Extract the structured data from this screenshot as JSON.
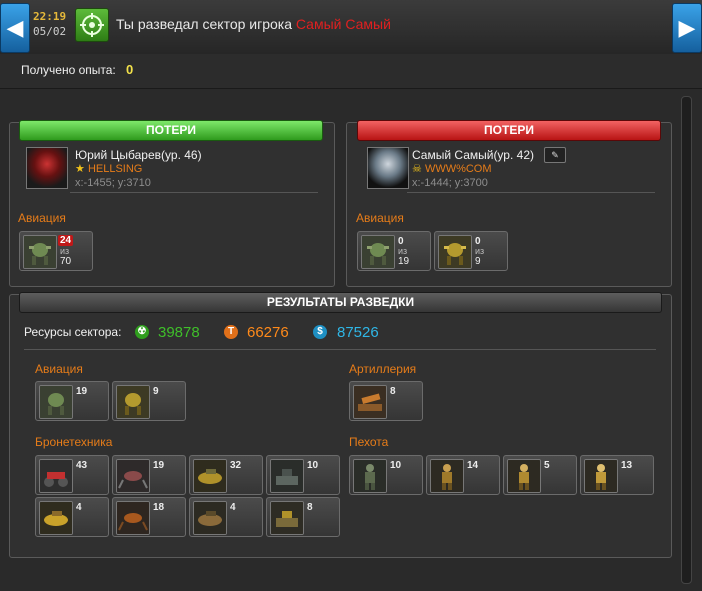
{
  "header": {
    "time": "22:19",
    "date": "05/02",
    "message": "Ты разведал сектор игрока",
    "target_name": "Самый Самый"
  },
  "experience": {
    "label": "Получено опыта:",
    "value": "0"
  },
  "attacker": {
    "losses_header": "ПОТЕРИ",
    "name": "Юрий Цыбарев(ур. 46)",
    "clan": "HELLSING",
    "coords": "x:-1455; y:3710",
    "section": "Авиация",
    "units": [
      {
        "lost": "24",
        "of": "из",
        "total": "70"
      }
    ]
  },
  "defender": {
    "losses_header": "ПОТЕРИ",
    "name": "Самый Самый(ур. 42)",
    "clan": "WWW%COM",
    "coords": "x:-1444; y:3700",
    "section": "Авиация",
    "units": [
      {
        "lost": "0",
        "of": "из",
        "total": "19"
      },
      {
        "lost": "0",
        "of": "из",
        "total": "9"
      }
    ]
  },
  "results": {
    "header": "РЕЗУЛЬТАТЫ РАЗВЕДКИ",
    "resources_label": "Ресурсы сектора:",
    "resources": [
      {
        "icon": "radiation-icon",
        "value": "39878",
        "color": "#3fbf2a"
      },
      {
        "icon": "titanium-icon",
        "value": "66276",
        "color": "#ff8a1a"
      },
      {
        "icon": "dollar-icon",
        "value": "87526",
        "color": "#2fb6e6"
      }
    ],
    "aviation": {
      "label": "Авиация",
      "counts": [
        "19",
        "9"
      ]
    },
    "artillery": {
      "label": "Артиллерия",
      "counts": [
        "8"
      ]
    },
    "armor": {
      "label": "Бронетехника",
      "counts": [
        "43",
        "19",
        "32",
        "10",
        "4",
        "18",
        "4",
        "8"
      ]
    },
    "infantry": {
      "label": "Пехота",
      "counts": [
        "10",
        "14",
        "5",
        "13"
      ]
    }
  }
}
